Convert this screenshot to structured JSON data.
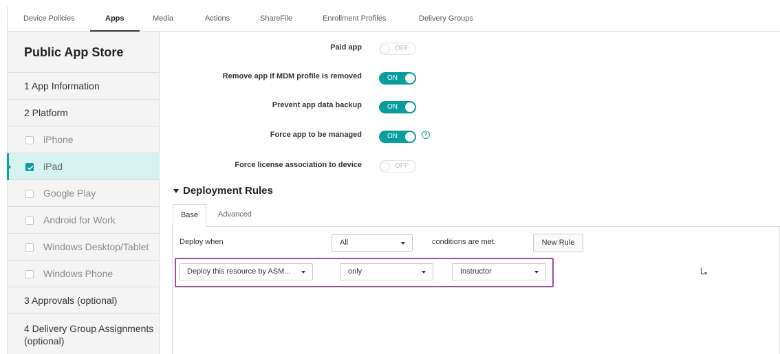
{
  "top_tabs": [
    {
      "label": "Device Policies",
      "active": false
    },
    {
      "label": "Apps",
      "active": true
    },
    {
      "label": "Media",
      "active": false
    },
    {
      "label": "Actions",
      "active": false
    },
    {
      "label": "ShareFile",
      "active": false
    },
    {
      "label": "Enrollment Profiles",
      "active": false
    },
    {
      "label": "Delivery Groups",
      "active": false
    }
  ],
  "sidebar": {
    "title": "Public App Store",
    "steps": [
      {
        "label": "1 App Information"
      },
      {
        "label": "2 Platform"
      }
    ],
    "platforms": [
      {
        "label": "iPhone",
        "checked": false,
        "active": false
      },
      {
        "label": "iPad",
        "checked": true,
        "active": true
      },
      {
        "label": "Google Play",
        "checked": false,
        "active": false
      },
      {
        "label": "Android for Work",
        "checked": false,
        "active": false
      },
      {
        "label": "Windows Desktop/Tablet",
        "checked": false,
        "active": false
      },
      {
        "label": "Windows Phone",
        "checked": false,
        "active": false
      }
    ],
    "steps_after": [
      {
        "label": "3 Approvals (optional)"
      },
      {
        "label": "4 Delivery Group Assignments (optional)"
      }
    ]
  },
  "settings": [
    {
      "label": "Paid app",
      "state": "OFF"
    },
    {
      "label": "Remove app if MDM profile is removed",
      "state": "ON"
    },
    {
      "label": "Prevent app data backup",
      "state": "ON"
    },
    {
      "label": "Force app to be managed",
      "state": "ON",
      "help_icon": "question-circle-icon"
    },
    {
      "label": "Force license association to device",
      "state": "OFF"
    }
  ],
  "deployment_rules": {
    "title": "Deployment Rules",
    "tabs": [
      {
        "label": "Base",
        "active": true
      },
      {
        "label": "Advanced",
        "active": false
      }
    ],
    "deploy_when_label": "Deploy when",
    "condition_select": "All",
    "conditions_text": "conditions are met.",
    "new_rule_label": "New Rule",
    "rule": {
      "resource_select": "Deploy this resource by ASM...",
      "operator_select": "only",
      "value_select": "Instructor",
      "delete_icon": "remove-rule-icon"
    }
  },
  "colors": {
    "accent": "#089c9b",
    "active_row": "#d5f2f1",
    "highlight_border": "#9a4fa5"
  }
}
